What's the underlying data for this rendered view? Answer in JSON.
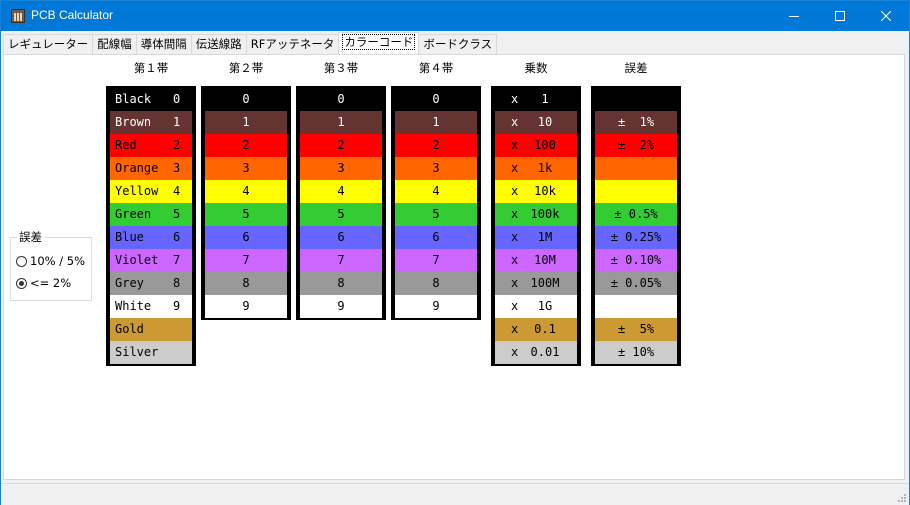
{
  "window": {
    "title": "PCB Calculator",
    "minimize_icon": "minimize-icon",
    "maximize_icon": "maximize-icon",
    "close_icon": "close-icon"
  },
  "tabs": [
    {
      "label": "レギュレーター",
      "active": false
    },
    {
      "label": "配線幅",
      "active": false
    },
    {
      "label": "導体間隔",
      "active": false
    },
    {
      "label": "伝送線路",
      "active": false
    },
    {
      "label": "RFアッテネータ",
      "active": false
    },
    {
      "label": "カラーコード",
      "active": true
    },
    {
      "label": "ボードクラス",
      "active": false
    }
  ],
  "tolerance_group": {
    "title": "誤差",
    "options": [
      {
        "label": "10% / 5%",
        "selected": false
      },
      {
        "label": "<= 2%",
        "selected": true
      }
    ]
  },
  "headers": {
    "band1": "第１帯",
    "band2": "第２帯",
    "band3": "第３帯",
    "band4": "第４帯",
    "multiplier": "乗数",
    "tolerance": "誤差"
  },
  "colors": [
    {
      "name": "Black",
      "digit": "0",
      "multiplier": "1",
      "tolerance": "",
      "bg": "#000000",
      "fg": "#ffffff"
    },
    {
      "name": "Brown",
      "digit": "1",
      "multiplier": "10",
      "tolerance": "±  1%",
      "bg": "#663333",
      "fg": "#ffffff"
    },
    {
      "name": "Red",
      "digit": "2",
      "multiplier": "100",
      "tolerance": "±  2%",
      "bg": "#ff0000",
      "fg": "#000000"
    },
    {
      "name": "Orange",
      "digit": "3",
      "multiplier": "1k",
      "tolerance": "",
      "bg": "#ff6600",
      "fg": "#000000"
    },
    {
      "name": "Yellow",
      "digit": "4",
      "multiplier": "10k",
      "tolerance": "",
      "bg": "#ffff00",
      "fg": "#000000"
    },
    {
      "name": "Green",
      "digit": "5",
      "multiplier": "100k",
      "tolerance": "± 0.5%",
      "bg": "#33cc33",
      "fg": "#000000"
    },
    {
      "name": "Blue",
      "digit": "6",
      "multiplier": "1M",
      "tolerance": "± 0.25%",
      "bg": "#6666ff",
      "fg": "#000000"
    },
    {
      "name": "Violet",
      "digit": "7",
      "multiplier": "10M",
      "tolerance": "± 0.10%",
      "bg": "#cc66ff",
      "fg": "#000000"
    },
    {
      "name": "Grey",
      "digit": "8",
      "multiplier": "100M",
      "tolerance": "± 0.05%",
      "bg": "#999999",
      "fg": "#000000"
    },
    {
      "name": "White",
      "digit": "9",
      "multiplier": "1G",
      "tolerance": "",
      "bg": "#ffffff",
      "fg": "#000000"
    },
    {
      "name": "Gold",
      "digit": "",
      "multiplier": "0.1",
      "tolerance": "±  5%",
      "bg": "#cc9933",
      "fg": "#000000"
    },
    {
      "name": "Silver",
      "digit": "",
      "multiplier": "0.01",
      "tolerance": "± 10%",
      "bg": "#cccccc",
      "fg": "#000000"
    }
  ],
  "multiplier_prefix": "x"
}
